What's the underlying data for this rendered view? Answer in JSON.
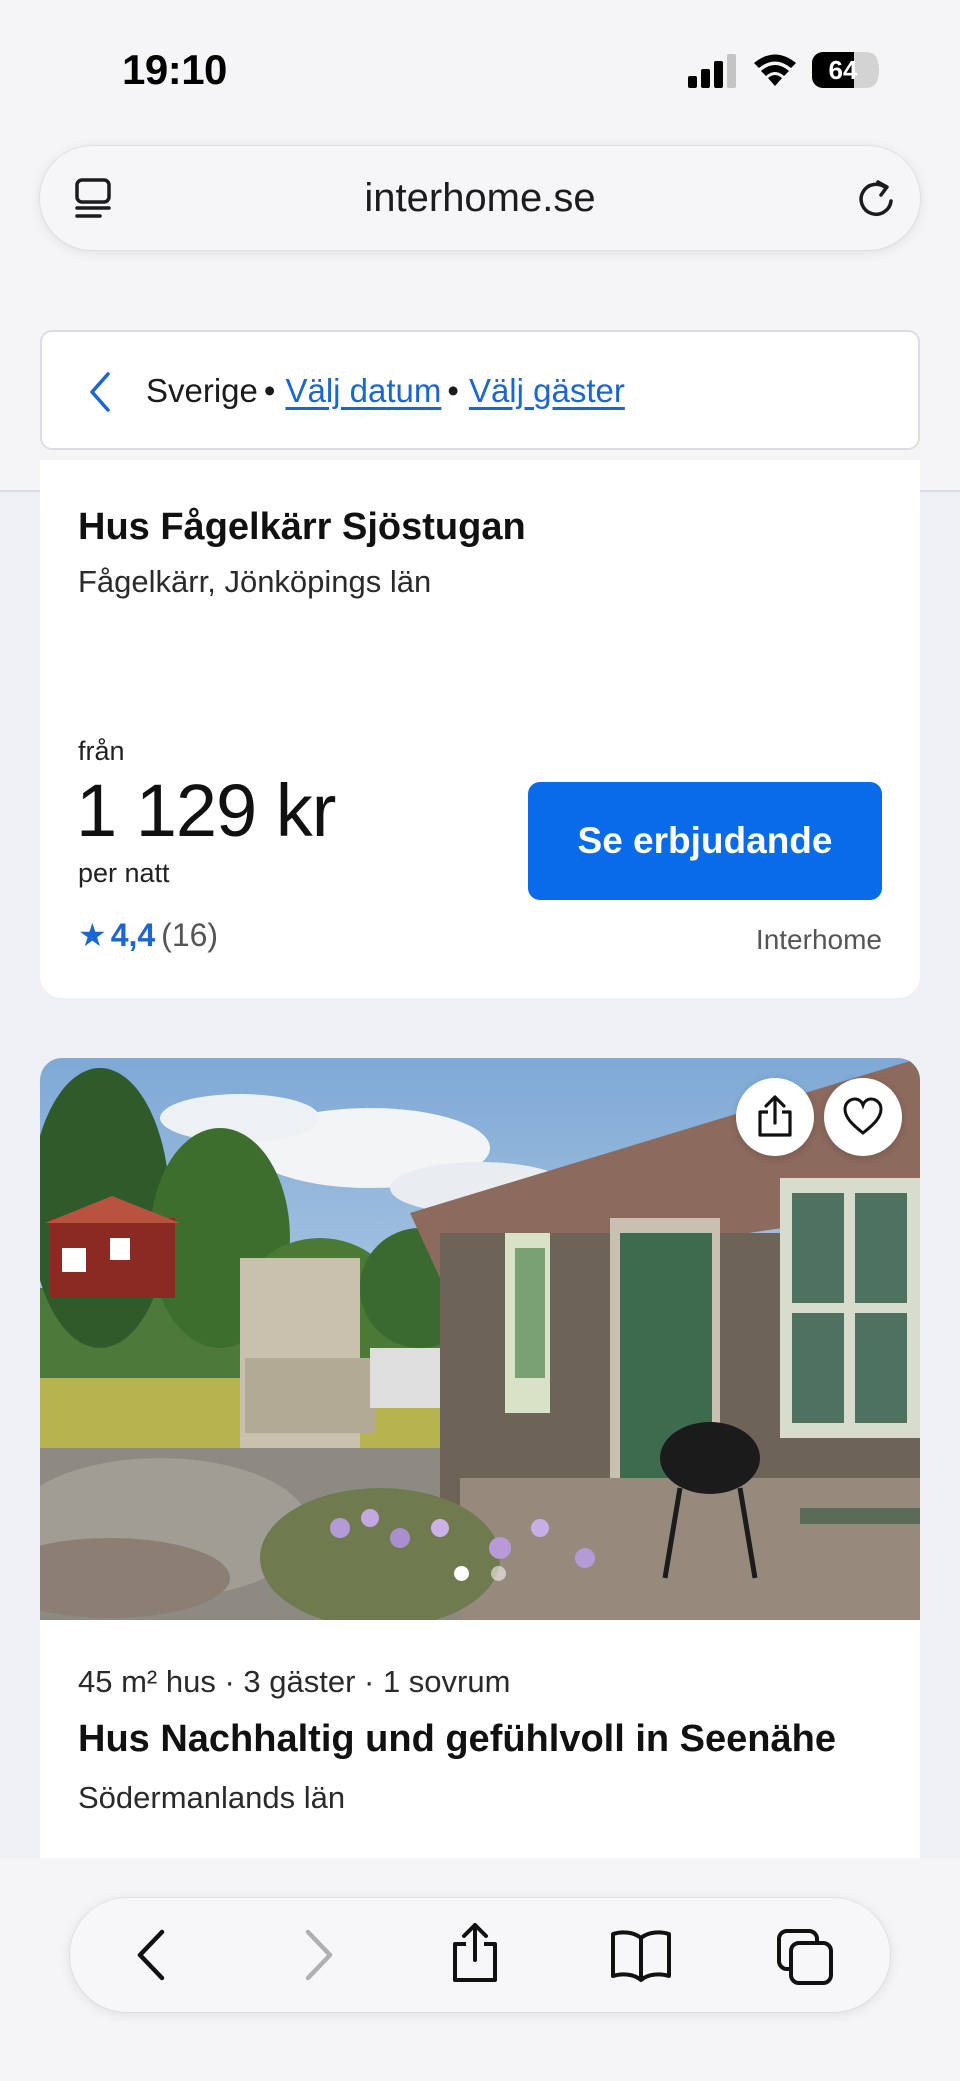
{
  "status_bar": {
    "time": "19:10",
    "battery_level": "64",
    "icons": [
      "cellular-signal-icon",
      "wifi-icon",
      "battery-icon"
    ]
  },
  "browser": {
    "url": "interhome.se",
    "icons": [
      "reader-mode-icon",
      "reload-icon"
    ]
  },
  "filters": {
    "country": "Sverige",
    "separator": "•",
    "date_link": "Välj datum",
    "guests_link": "Välj gäster"
  },
  "listings": [
    {
      "title": "Hus Fågelkärr Sjöstugan",
      "location": "Fågelkärr, Jönköpings län",
      "price_prefix": "från",
      "price": "1 129 kr",
      "price_suffix": "per natt",
      "rating_star": "★",
      "rating": "4,4",
      "reviews": "(16)",
      "cta": "Se erbjudande",
      "provider": "Interhome"
    },
    {
      "facts": "45 m² hus · 3 gäster · 1 sovrum",
      "title": "Hus Nachhaltig und gefühlvoll in Seenähe",
      "location": "Södermanlands län",
      "photo_count_visible": 2,
      "active_photo": 1,
      "icons": [
        "share-icon",
        "heart-icon"
      ]
    }
  ],
  "toolbar": {
    "icons": [
      "back-icon",
      "forward-icon",
      "share-icon",
      "bookmarks-icon",
      "tabs-icon"
    ],
    "forward_enabled": false
  },
  "colors": {
    "accent": "#0a6bea",
    "link": "#1a66d4",
    "page_bg": "#eff0f4"
  }
}
